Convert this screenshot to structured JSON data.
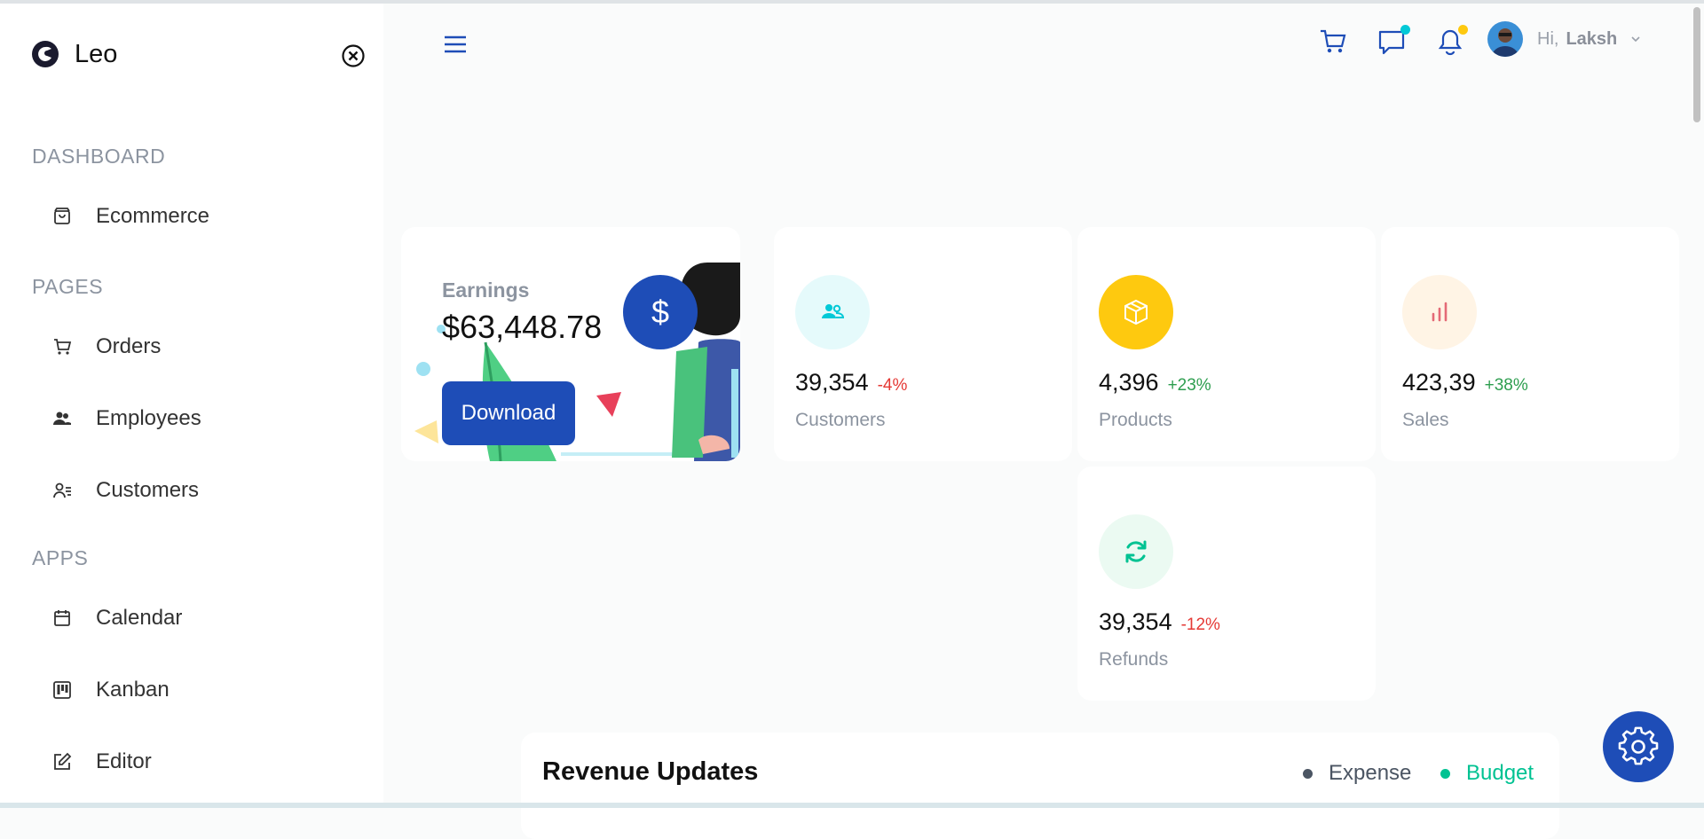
{
  "sidebar": {
    "brand": "Leo",
    "sections": [
      {
        "title": "DASHBOARD",
        "items": [
          {
            "label": "Ecommerce",
            "icon": "shopping-bag-icon"
          }
        ]
      },
      {
        "title": "PAGES",
        "items": [
          {
            "label": "Orders",
            "icon": "cart-icon"
          },
          {
            "label": "Employees",
            "icon": "users-icon"
          },
          {
            "label": "Customers",
            "icon": "user-list-icon"
          }
        ]
      },
      {
        "title": "APPS",
        "items": [
          {
            "label": "Calendar",
            "icon": "calendar-icon"
          },
          {
            "label": "Kanban",
            "icon": "kanban-icon"
          },
          {
            "label": "Editor",
            "icon": "edit-icon"
          }
        ]
      }
    ]
  },
  "header": {
    "greeting": "Hi,",
    "username": "Laksh",
    "notification_colors": {
      "chat": "#03c9d7",
      "bell": "#fec90f"
    }
  },
  "earnings": {
    "label": "Earnings",
    "value": "$63,448.78",
    "currency_symbol": "$",
    "button": "Download"
  },
  "stats": [
    {
      "value": "39,354",
      "percent": "-4%",
      "label": "Customers",
      "pct_color": "#e53935",
      "icon_bg": "#e5fafb",
      "icon_color": "#03c9d7",
      "icon": "users-icon"
    },
    {
      "value": "4,396",
      "percent": "+23%",
      "label": "Products",
      "pct_color": "#2e9e4f",
      "icon_bg": "#fec90f",
      "icon_color": "#ffffff",
      "icon": "box-icon"
    },
    {
      "value": "423,39",
      "percent": "+38%",
      "label": "Sales",
      "pct_color": "#2e9e4f",
      "icon_bg": "#fff4e5",
      "icon_color": "#e46a76",
      "icon": "bar-chart-icon"
    },
    {
      "value": "39,354",
      "percent": "-12%",
      "label": "Refunds",
      "pct_color": "#e53935",
      "icon_bg": "#ebfaf2",
      "icon_color": "#00c292",
      "icon": "refresh-icon"
    }
  ],
  "revenue": {
    "title": "Revenue Updates",
    "legend": [
      {
        "label": "Expense",
        "color": "#4b5563"
      },
      {
        "label": "Budget",
        "color": "#00c292"
      }
    ]
  },
  "colors": {
    "primary": "#1e4db7"
  }
}
